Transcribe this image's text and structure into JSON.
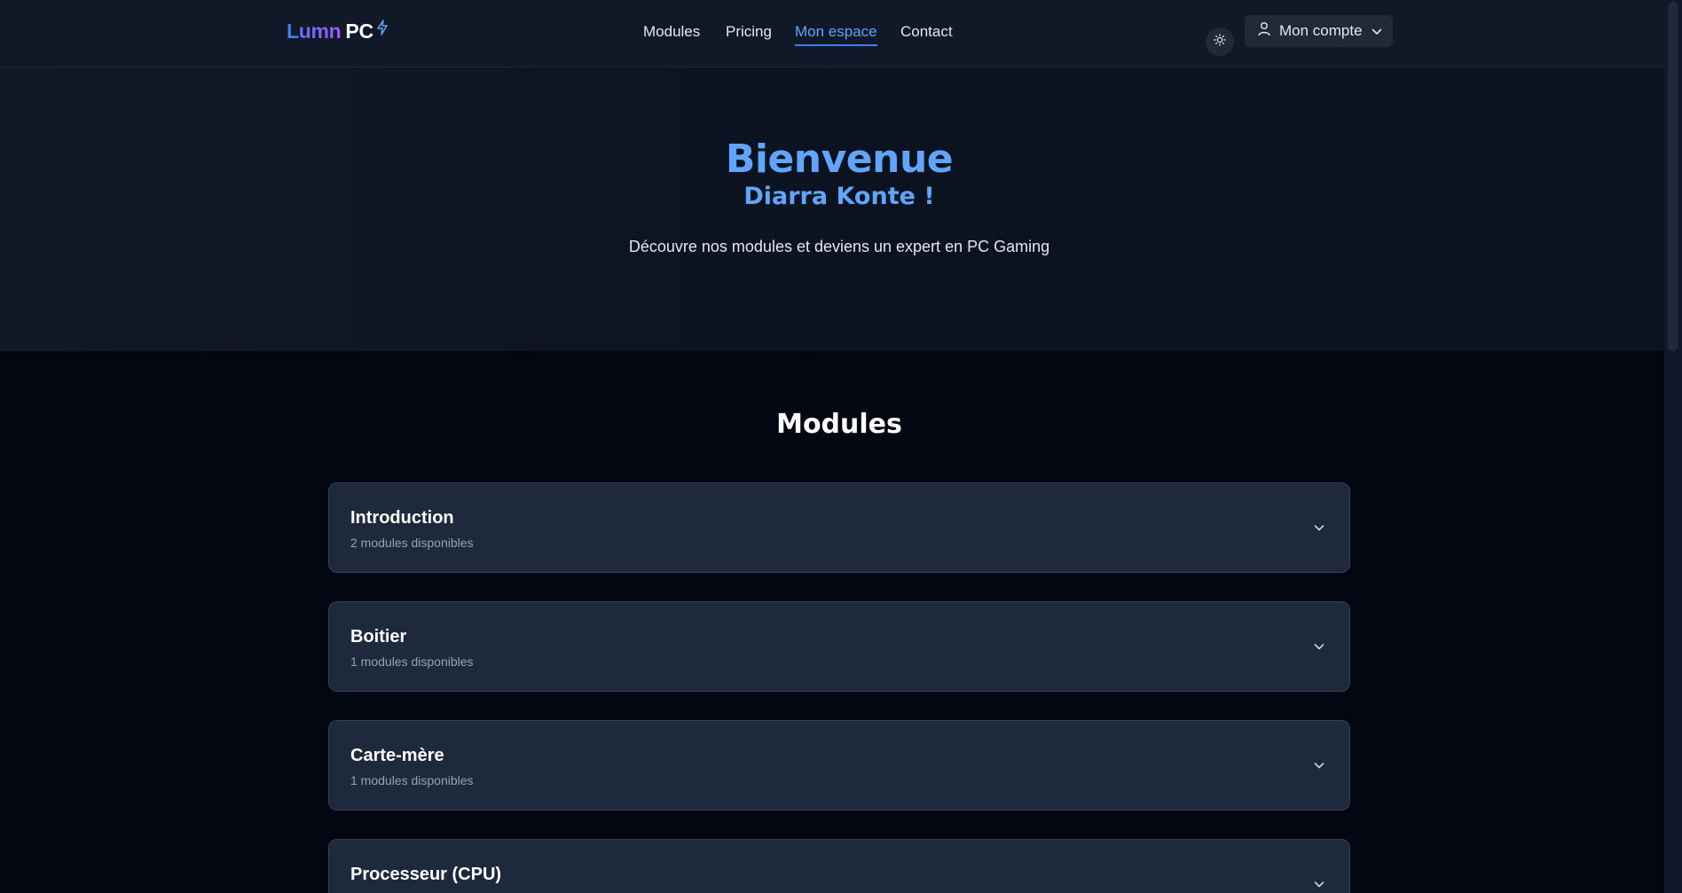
{
  "header": {
    "logo_part1": "Lumn",
    "logo_part2": "PC",
    "nav": [
      {
        "label": "Modules"
      },
      {
        "label": "Pricing"
      },
      {
        "label": "Mon espace",
        "active": true
      },
      {
        "label": "Contact"
      }
    ],
    "theme_icon": "sun-icon",
    "account_label": "Mon compte",
    "account_icon": "user-icon"
  },
  "hero": {
    "title": "Bienvenue",
    "subtitle": "Diarra Konte !",
    "tagline": "Découvre nos modules et deviens un expert en PC Gaming"
  },
  "modules": {
    "heading": "Modules",
    "items": [
      {
        "title": "Introduction",
        "subtitle": "2 modules disponibles"
      },
      {
        "title": "Boitier",
        "subtitle": "1 modules disponibles"
      },
      {
        "title": "Carte-mère",
        "subtitle": "1 modules disponibles"
      },
      {
        "title": "Processeur (CPU)",
        "subtitle": ""
      }
    ]
  },
  "colors": {
    "accent": "#3b82f6",
    "accent_text": "#60a5fa",
    "card_bg": "#1e293b",
    "page_bg": "#030712"
  }
}
